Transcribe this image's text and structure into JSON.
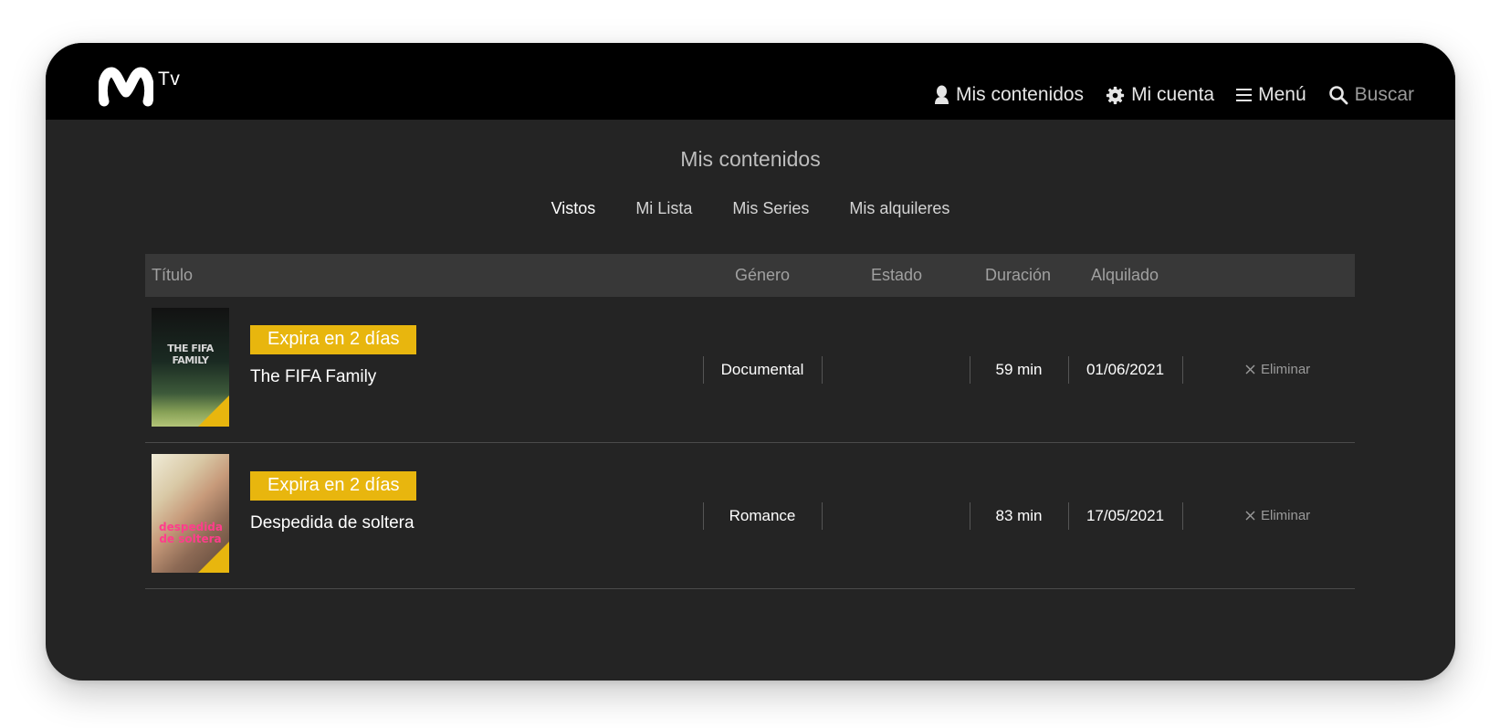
{
  "brand": {
    "logo_text": "Tv"
  },
  "nav": {
    "my_content": "Mis contenidos",
    "my_account": "Mi cuenta",
    "menu": "Menú",
    "search": "Buscar"
  },
  "page": {
    "title": "Mis contenidos",
    "tabs": [
      {
        "label": "Vistos",
        "active": true
      },
      {
        "label": "Mi Lista",
        "active": false
      },
      {
        "label": "Mis Series",
        "active": false
      },
      {
        "label": "Mis alquileres",
        "active": false
      }
    ]
  },
  "table": {
    "headers": {
      "title": "Título",
      "genre": "Género",
      "status": "Estado",
      "duration": "Duración",
      "rented": "Alquilado"
    },
    "rows": [
      {
        "badge": "Expira en 2 días",
        "title": "The FIFA Family",
        "genre": "Documental",
        "status": "",
        "duration": "59 min",
        "rented": "01/06/2021",
        "delete_label": "Eliminar",
        "poster_text": "THE FIFA FAMILY"
      },
      {
        "badge": "Expira en 2 días",
        "title": "Despedida de soltera",
        "genre": "Romance",
        "status": "",
        "duration": "83 min",
        "rented": "17/05/2021",
        "delete_label": "Eliminar",
        "poster_text": "despedida de soltera"
      }
    ]
  },
  "colors": {
    "accent": "#e8b60e",
    "background": "#242424",
    "header": "#000000",
    "table_header": "#383838"
  }
}
